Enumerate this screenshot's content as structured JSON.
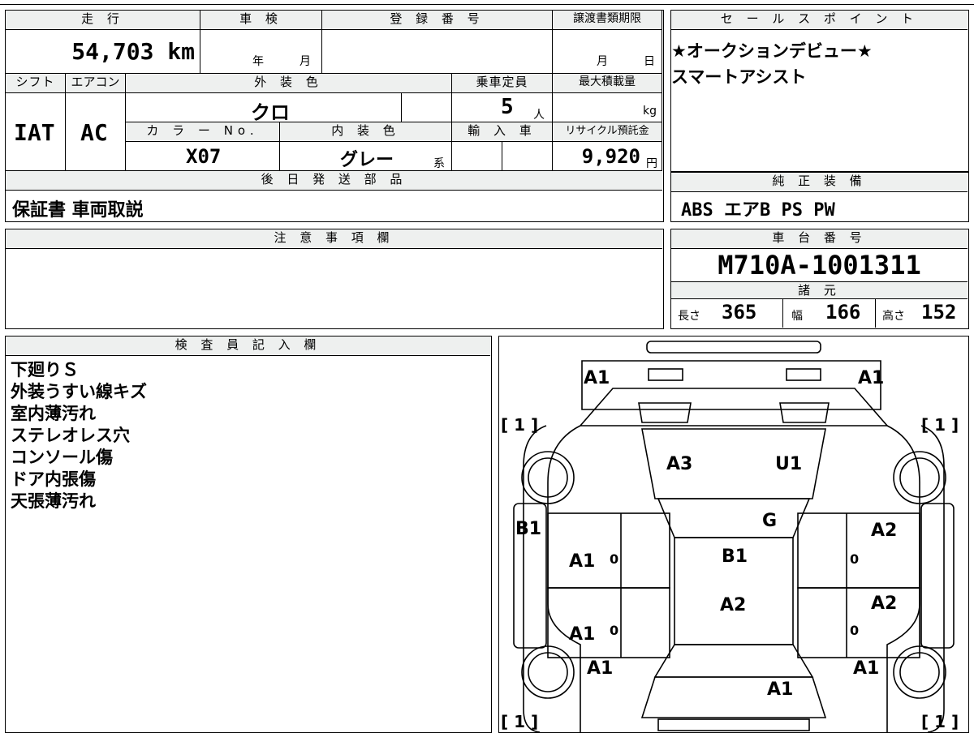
{
  "vehicle": {
    "labels": {
      "mileage": "走 行",
      "inspection": "車 検",
      "registration": "登 録 番 号",
      "transfer_deadline": "譲渡書類期限",
      "shift": "シフト",
      "aircon": "エアコン",
      "exterior_color": "外 装 色",
      "capacity": "乗車定員",
      "max_load": "最大積載量",
      "color_no": "カ ラ ー No.",
      "interior_color": "内 装 色",
      "import": "輸 入 車",
      "recycle_fee": "リサイクル預託金",
      "later_parts": "後 日 発 送 部 品"
    },
    "mileage": "54,703 km",
    "year_unit": "年",
    "month_unit": "月",
    "day_unit": "日",
    "shift": "IAT",
    "aircon": "AC",
    "exterior_color": "クロ",
    "capacity": "5",
    "capacity_unit": "人",
    "load_unit": "kg",
    "color_no": "X07",
    "interior_color": "グレー",
    "interior_suffix": "系",
    "recycle_fee": "9,920",
    "yen": "円",
    "later_parts": "保証書 車両取説"
  },
  "sales": {
    "title": "セ ー ル ス ポ イ ン ト",
    "line1": "★オークションデビュー★",
    "line2": "スマートアシスト"
  },
  "equipment": {
    "title": "純 正 装 備",
    "value": "ABS エアB PS PW"
  },
  "notes": {
    "title": "注 意 事 項 欄"
  },
  "chassis": {
    "title": "車 台 番 号",
    "value": "M710A-1001311",
    "specs_title": "諸 元",
    "length_label": "長さ",
    "length": "365",
    "width_label": "幅",
    "width": "166",
    "height_label": "高さ",
    "height": "152"
  },
  "inspector": {
    "title": "検 査 員 記 入 欄",
    "lines": [
      "下廻りＳ",
      "外装うすい線キズ",
      "室内薄汚れ",
      "ステレオレス穴",
      "コンソール傷",
      "ドア内張傷",
      "天張薄汚れ"
    ]
  },
  "diagram": {
    "marks": [
      "A1",
      "A1",
      "A3",
      "U1",
      "G",
      "B1",
      "A2",
      "B1",
      "A1",
      "A2",
      "A2",
      "A1",
      "A1",
      "A1",
      "A1"
    ],
    "brackets": [
      "[ 1 ]",
      "[ 1 ]",
      "[ 1 ]",
      "[ 1 ]"
    ],
    "zeros": [
      "0",
      "0",
      "0",
      "0"
    ]
  }
}
